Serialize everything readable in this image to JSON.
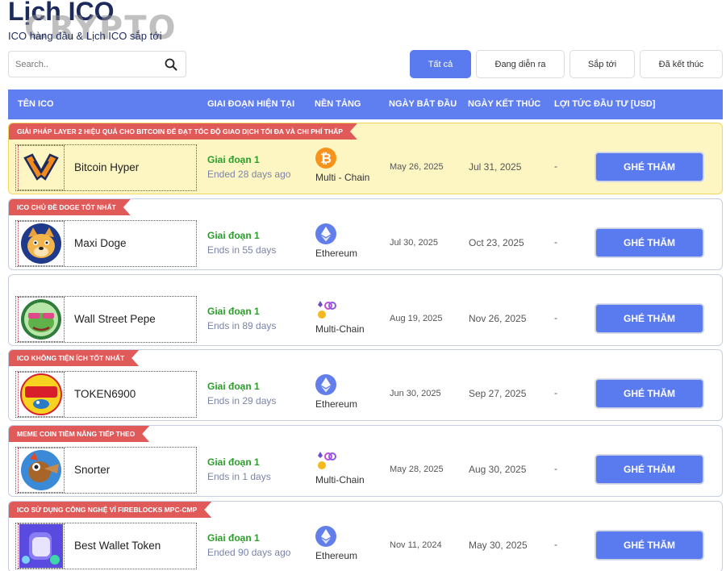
{
  "header": {
    "title": "Lịch ICO",
    "watermark": "CRYPTO",
    "subtitle": "ICO hàng đầu & Lịch ICO sắp tới"
  },
  "search": {
    "placeholder": "Search.."
  },
  "tabs": [
    {
      "label": "Tất cả",
      "active": true
    },
    {
      "label": "Đang diễn ra",
      "active": false
    },
    {
      "label": "Sắp tới",
      "active": false
    },
    {
      "label": "Đã kết thúc",
      "active": false
    }
  ],
  "table": {
    "headers": [
      "TÊN ICO",
      "GIAI ĐOẠN HIỆN TẠI",
      "NỀN TẢNG",
      "NGÀY BẮT ĐẦU",
      "NGÀY KẾT THÚC",
      "LỢI TỨC ĐẦU TƯ [USD]"
    ],
    "visit_label": "GHÉ THĂM",
    "rows": [
      {
        "ribbon": "GIẢI PHÁP LAYER 2 HIỆU QUẢ CHO BITCOIN ĐỂ ĐẠT TỐC ĐỘ GIAO DỊCH TỐI ĐA VÀ CHI PHÍ THẤP",
        "name": "Bitcoin Hyper",
        "stage": "Giai đoạn 1",
        "ends": "Ended 28 days ago",
        "platform": "Multi - Chain",
        "platform_icon": "bitcoin-icon",
        "start": "May 26, 2025",
        "end": "Jul 31, 2025",
        "roi": "-",
        "highlight": true
      },
      {
        "ribbon": "ICO CHỦ ĐỀ DOGE TỐT NHẤT",
        "name": "Maxi Doge",
        "stage": "Giai đoạn 1",
        "ends": "Ends in 55 days",
        "platform": "Ethereum",
        "platform_icon": "ethereum-icon",
        "start": "Jul 30, 2025",
        "end": "Oct 23, 2025",
        "roi": "-",
        "highlight": false
      },
      {
        "ribbon": "",
        "name": "Wall Street Pepe",
        "stage": "Giai đoạn 1",
        "ends": "Ends in 89 days",
        "platform": "Multi-Chain",
        "platform_icon": "multichain-icon",
        "start": "Aug 19, 2025",
        "end": "Nov 26, 2025",
        "roi": "-",
        "highlight": false
      },
      {
        "ribbon": "ICO KHÔNG TIỆN ÍCH TỐT NHẤT",
        "name": "TOKEN6900",
        "stage": "Giai đoạn 1",
        "ends": "Ends in 29 days",
        "platform": "Ethereum",
        "platform_icon": "ethereum-icon",
        "start": "Jun 30, 2025",
        "end": "Sep 27, 2025",
        "roi": "-",
        "highlight": false
      },
      {
        "ribbon": "MEME COIN TIỀM NĂNG TIẾP THEO",
        "name": "Snorter",
        "stage": "Giai đoạn 1",
        "ends": "Ends in 1 days",
        "platform": "Multi-Chain",
        "platform_icon": "multichain-icon",
        "start": "May 28, 2025",
        "end": "Aug 30, 2025",
        "roi": "-",
        "highlight": false
      },
      {
        "ribbon": "ICO SỬ DỤNG CÔNG NGHỆ VÍ FIREBLOCKS MPC-CMP",
        "name": "Best Wallet Token",
        "stage": "Giai đoạn 1",
        "ends": "Ended 90 days ago",
        "platform": "Ethereum",
        "platform_icon": "ethereum-icon",
        "start": "Nov 11, 2024",
        "end": "May 30, 2025",
        "roi": "-",
        "highlight": false
      }
    ]
  },
  "colors": {
    "accent": "#5a7af0",
    "ribbon": "#e05a5a",
    "stage_green": "#2d9c2d",
    "highlight_bg": "#fdf6c3"
  }
}
